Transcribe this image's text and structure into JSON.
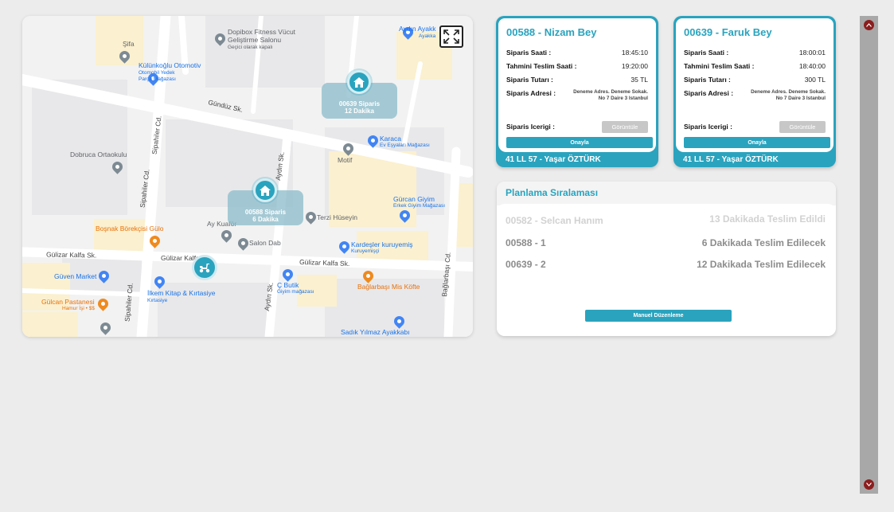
{
  "map": {
    "labels": {
      "sifa": "Şifa",
      "kulunkoglu": "Külünkoğlu Otomotiv",
      "kulunkoglu_sub1": "Otomobil Yedek",
      "kulunkoglu_sub2": "Parça Mağazası",
      "dopibox": "Dopibox Fitness Vücut",
      "dopibox2": "Geliştirme Salonu",
      "dopibox_sub": "Geçici olarak kapalı",
      "aydin_ayakk": "Aydın Ayakk",
      "aydin_ayakk_sub": "Ayakka",
      "gunduz": "Gündüz Sk.",
      "sipahiler_cd1": "Sipahiler Cd.",
      "sipahiler_cd2": "Sipahiler Cd.",
      "sipahiler_cd3": "Sipahiler Cd.",
      "dobruca": "Dobruca Ortaokulu",
      "karaca": "Karaca",
      "karaca_sub": "Ev Eşyaları Mağazası",
      "motif": "Motif",
      "aydin_sk1": "Aydın Sk.",
      "aydin_sk2": "Aydın Sk.",
      "gurcan": "Gürcan Giyim",
      "gurcan_sub": "Erkek Giyim Mağazası",
      "bosnak": "Boşnak Börekçisi Gülo",
      "ay_kuafor": "Ay Kuaför",
      "terzi": "Terzi Hüseyin",
      "salon_dab": "Salon Dab",
      "kardesler": "Kardeşler kuruyemiş",
      "kardesler_sub": "Kuruyemişçi",
      "gulizar1": "Gülizar Kalfa Sk.",
      "gulizar2": "Gülizar Kalfa Sk.",
      "gulizar3": "Gülizar Kalfa Sk.",
      "baglarbasi_cd": "Bağlarbaşı Cd.",
      "guven": "Güven Market",
      "c_butik": "Ç Butik",
      "c_butik_sub": "Giyim mağazası",
      "baglarbasi_kofte": "Bağlarbaşı Mis Köfte",
      "ilkem": "İlkem Kitap & Kırtasiye",
      "ilkem_sub": "Kırtasiye",
      "gulcan": "Gülcan Pastanesi",
      "gulcan_sub": "Hamur İşi • $$",
      "sadik": "Sadık Yılmaz Ayakkabı"
    },
    "markers": [
      {
        "line1": "00639 Siparis",
        "line2": "12 Dakika"
      },
      {
        "line1": "00588 Siparis",
        "line2": "6 Dakika"
      }
    ]
  },
  "orders": [
    {
      "title": "00588 - Nizam Bey",
      "fields": [
        {
          "key": "Siparis Saati :",
          "value": "18:45:10"
        },
        {
          "key": "Tahmini Teslim Saati :",
          "value": "19:20:00"
        },
        {
          "key": "Siparis Tutarı :",
          "value": "35 TL"
        }
      ],
      "address_key": "Siparis Adresi :",
      "address_value": "Deneme Adres. Deneme Sokak. No 7 Daire 3 Istanbul",
      "content_key": "Siparis Icerigi :",
      "view_label": "Görüntüle",
      "approve_label": "Onayla",
      "footer": "41 LL 57 - Yaşar ÖZTÜRK"
    },
    {
      "title": "00639 - Faruk Bey",
      "fields": [
        {
          "key": "Siparis Saati :",
          "value": "18:00:01"
        },
        {
          "key": "Tahmini Teslim Saati :",
          "value": "18:40:00"
        },
        {
          "key": "Siparis Tutarı :",
          "value": "300 TL"
        }
      ],
      "address_key": "Siparis Adresi :",
      "address_value": "Deneme Adres. Deneme Sokak. No 7 Daire 3 Istanbul",
      "content_key": "Siparis Icerigi :",
      "view_label": "Görüntüle",
      "approve_label": "Onayla",
      "footer": "41 LL 57 - Yaşar ÖZTÜRK"
    }
  ],
  "planning": {
    "title": "Planlama Sıralaması",
    "items": [
      {
        "left": "00582 - Selcan Hanım",
        "right": "13 Dakikada Teslim Edildi",
        "status": "done"
      },
      {
        "left": "00588 - 1",
        "right": "6 Dakikada Teslim Edilecek",
        "status": "todo"
      },
      {
        "left": "00639 - 2",
        "right": "12 Dakikada Teslim Edilecek",
        "status": "todo"
      }
    ],
    "manual_label": "Manuel Düzenleme"
  },
  "colors": {
    "accent": "#2aa3be",
    "scroll_arrow": "#8b1e1e"
  }
}
